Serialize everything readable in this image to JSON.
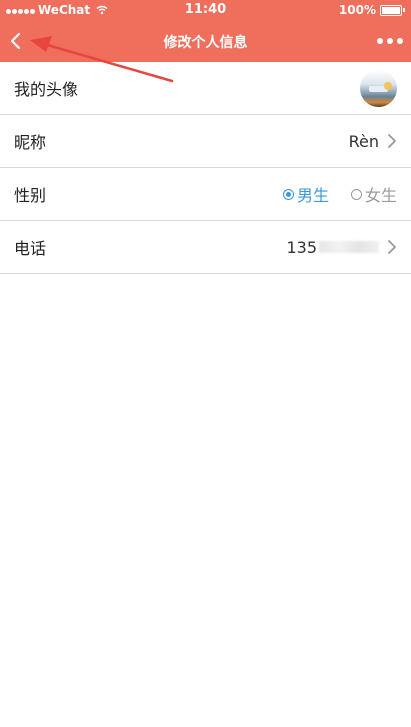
{
  "status_bar": {
    "carrier": "WeChat",
    "time": "11:40",
    "battery": "100%"
  },
  "nav": {
    "title": "修改个人信息"
  },
  "rows": {
    "avatar_label": "我的头像",
    "nickname_label": "昵称",
    "nickname_value": "Rèn",
    "gender_label": "性别",
    "gender_options": [
      "男生",
      "女生"
    ],
    "gender_selected": "男生",
    "phone_label": "电话",
    "phone_value": "135"
  },
  "colors": {
    "accent": "#ef6e5c",
    "radio_selected": "#3b96e0",
    "annotation_arrow": "#e8453c"
  },
  "icons": {
    "back": "chevron-left-icon",
    "more": "more-dots-icon",
    "chevron": "chevron-right-icon"
  }
}
